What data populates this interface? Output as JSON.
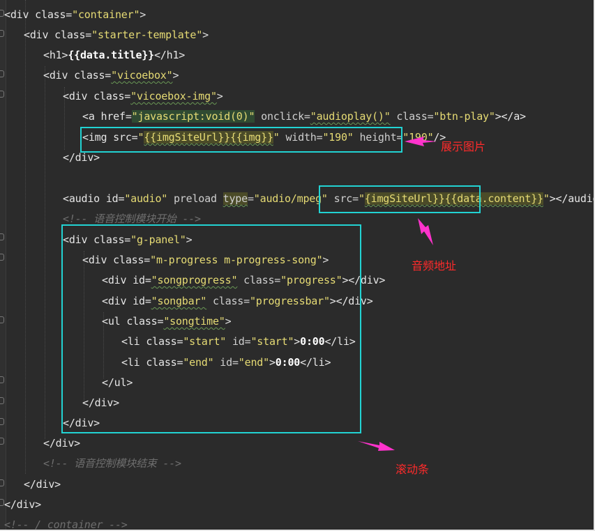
{
  "code": {
    "l1": {
      "open": "<div class=",
      "val": "\"container\"",
      "close": ">"
    },
    "l2": {
      "open": "<div class=",
      "val": "\"starter-template\"",
      "close": ">"
    },
    "l3": {
      "open": "<h1>",
      "expr": "{{data.title}}",
      "close": "</h1>"
    },
    "l4": {
      "open": "<div class=",
      "val": "\"vicoebox\"",
      "close": ">"
    },
    "l5": {
      "open": "<div class=",
      "val": "\"vicoebox-img\"",
      "close": ">"
    },
    "l6": {
      "a1": "<a href=",
      "v1": "\"javascript:void(0)\"",
      "a2": " onclick=",
      "v2": "\"audioplay()\"",
      "a3": " class=",
      "v3": "\"btn-play\"",
      "close": "></a>"
    },
    "l7": {
      "a1": "<img src=",
      "q1": "\"",
      "v1": "{{imgSiteUrl}}{{img}}",
      "q2": "\"",
      "a2": " width=",
      "v2": "\"190\"",
      "a3": " height=",
      "v3": "\"190\"",
      "close": "/>"
    },
    "l8": {
      "text": "</div>"
    },
    "l9": {
      "a1": "<audio id=",
      "v1": "\"audio\"",
      "a2": " preload ",
      "t": "type",
      "a3": "=",
      "v3": "\"audio/mpeg\"",
      "a4": " src=",
      "q1": "\"",
      "v4": "{imgSiteUrl}}{{data.content}}",
      "q2": "\"",
      "close": "></audio>"
    },
    "l10": {
      "text": "<!-- 语音控制模块开始 -->"
    },
    "l11": {
      "open": "<div class=",
      "val": "\"g-panel\"",
      "close": ">"
    },
    "l12": {
      "open": "<div class=",
      "val": "\"m-progress m-progress-song\"",
      "close": ">"
    },
    "l13": {
      "a1": "<div id=",
      "v1": "\"songprogress\"",
      "a2": " class=",
      "v2": "\"progress\"",
      "close": "></div>"
    },
    "l14": {
      "a1": "<div id=",
      "v1": "\"songbar\"",
      "a2": " class=",
      "v2": "\"progressbar\"",
      "close": "></div>"
    },
    "l15": {
      "open": "<ul class=",
      "val": "\"songtime\"",
      "close": ">"
    },
    "l16": {
      "a1": "<li class=",
      "v1": "\"start\"",
      "a2": " id=",
      "v2": "\"start\"",
      "c1": ">",
      "txt": "0:00",
      "close": "</li>"
    },
    "l17": {
      "a1": "<li class=",
      "v1": "\"end\"",
      "a2": " id=",
      "v2": "\"end\"",
      "c1": ">",
      "txt": "0:00",
      "close": "</li>"
    },
    "l18": {
      "text": "</ul>"
    },
    "l19": {
      "text": "</div>"
    },
    "l20": {
      "text": "</div>"
    },
    "l21": {
      "text": "</div>"
    },
    "l22": {
      "text": "<!-- 语音控制模块结束 -->"
    },
    "l23": {
      "text": "</div>"
    },
    "l24": {
      "text": "</div>"
    },
    "l25": {
      "text": "<!-- / container -->"
    }
  },
  "annotations": {
    "image_label": "展示图片",
    "audio_label": "音频地址",
    "scroll_label": "滚动条"
  },
  "colors": {
    "box": "#22d3d3",
    "arrow": "#ff33cc",
    "annotation_text": "#ff2b2b",
    "string": "#e6db74",
    "background": "#2b2b2b"
  }
}
